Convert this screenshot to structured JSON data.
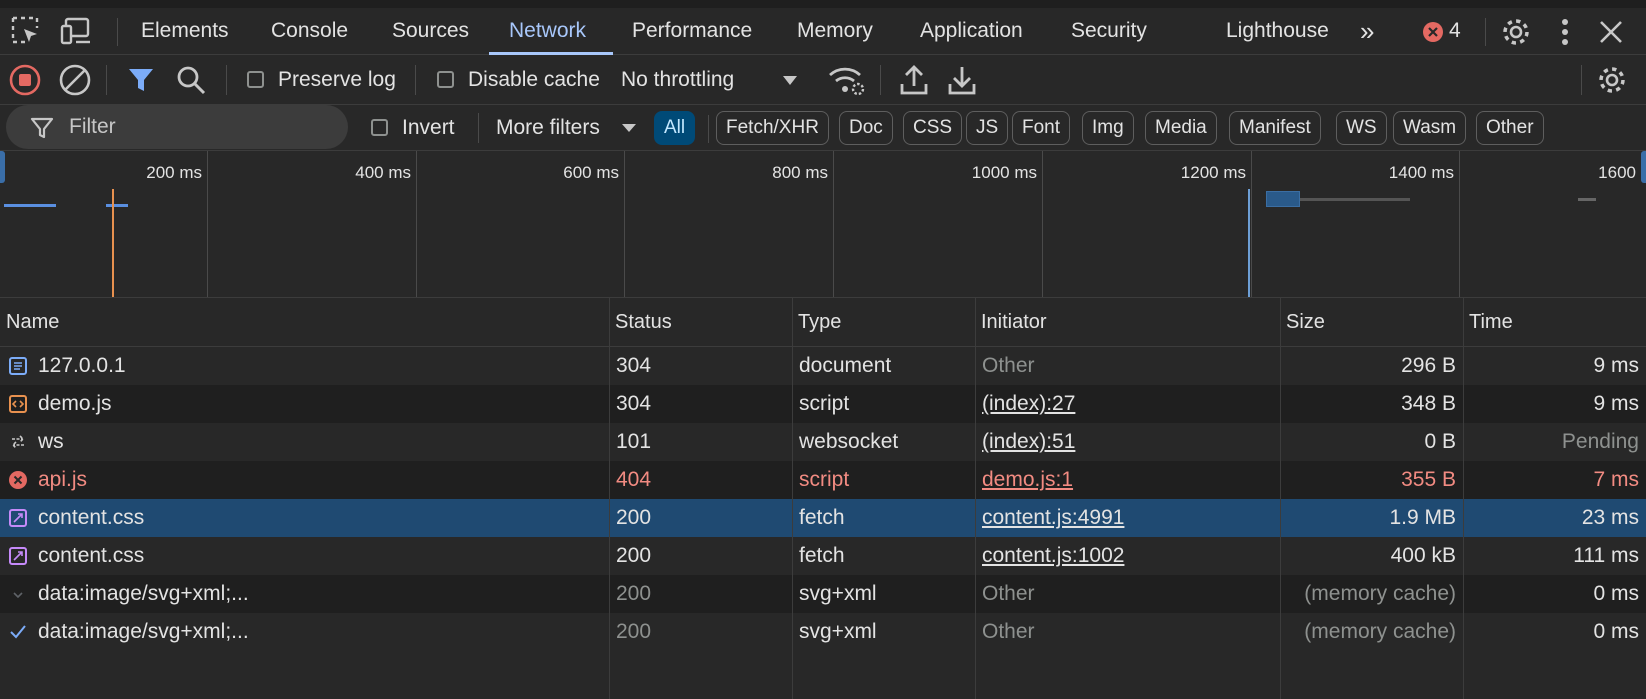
{
  "tabs": {
    "elements": "Elements",
    "console": "Console",
    "sources": "Sources",
    "network": "Network",
    "performance": "Performance",
    "memory": "Memory",
    "application": "Application",
    "security": "Security",
    "lighthouse": "Lighthouse",
    "more": "»",
    "error_count": "4"
  },
  "toolbar": {
    "preserve_log": "Preserve log",
    "disable_cache": "Disable cache",
    "throttling": "No throttling"
  },
  "filters": {
    "placeholder": "Filter",
    "invert": "Invert",
    "more_filters": "More filters",
    "types": [
      "All",
      "Fetch/XHR",
      "Doc",
      "CSS",
      "JS",
      "Font",
      "Img",
      "Media",
      "Manifest",
      "WS",
      "Wasm",
      "Other"
    ]
  },
  "overview": {
    "ticks": [
      "200 ms",
      "400 ms",
      "600 ms",
      "800 ms",
      "1000 ms",
      "1200 ms",
      "1400 ms",
      "1600"
    ]
  },
  "table": {
    "headers": {
      "name": "Name",
      "status": "Status",
      "type": "Type",
      "initiator": "Initiator",
      "size": "Size",
      "time": "Time"
    },
    "rows": [
      {
        "icon": "document-icon",
        "name": "127.0.0.1",
        "status": "304",
        "type": "document",
        "initiator": "Other",
        "size": "296 B",
        "time": "9 ms"
      },
      {
        "icon": "script-icon",
        "name": "demo.js",
        "status": "304",
        "type": "script",
        "initiator": "(index):27",
        "size": "348 B",
        "time": "9 ms"
      },
      {
        "icon": "websocket-icon",
        "name": "ws",
        "status": "101",
        "type": "websocket",
        "initiator": "(index):51",
        "size": "0 B",
        "time": "Pending"
      },
      {
        "icon": "error-icon",
        "name": "api.js",
        "status": "404",
        "type": "script",
        "initiator": "demo.js:1",
        "size": "355 B",
        "time": "7 ms"
      },
      {
        "icon": "fetch-icon",
        "name": "content.css",
        "status": "200",
        "type": "fetch",
        "initiator": "content.js:4991",
        "size": "1.9 MB",
        "time": "23 ms"
      },
      {
        "icon": "fetch-icon",
        "name": "content.css",
        "status": "200",
        "type": "fetch",
        "initiator": "content.js:1002",
        "size": "400 kB",
        "time": "111 ms"
      },
      {
        "icon": "chevron-icon",
        "name": "data:image/svg+xml;...",
        "status": "200",
        "type": "svg+xml",
        "initiator": "Other",
        "size": "(memory cache)",
        "time": "0 ms"
      },
      {
        "icon": "check-icon",
        "name": "data:image/svg+xml;...",
        "status": "200",
        "type": "svg+xml",
        "initiator": "Other",
        "size": "(memory cache)",
        "time": "0 ms"
      }
    ]
  },
  "colors": {
    "accent": "#a8c7fa",
    "error": "#f28b82",
    "selected_row": "#1f4a72",
    "dim": "#8e918f"
  }
}
